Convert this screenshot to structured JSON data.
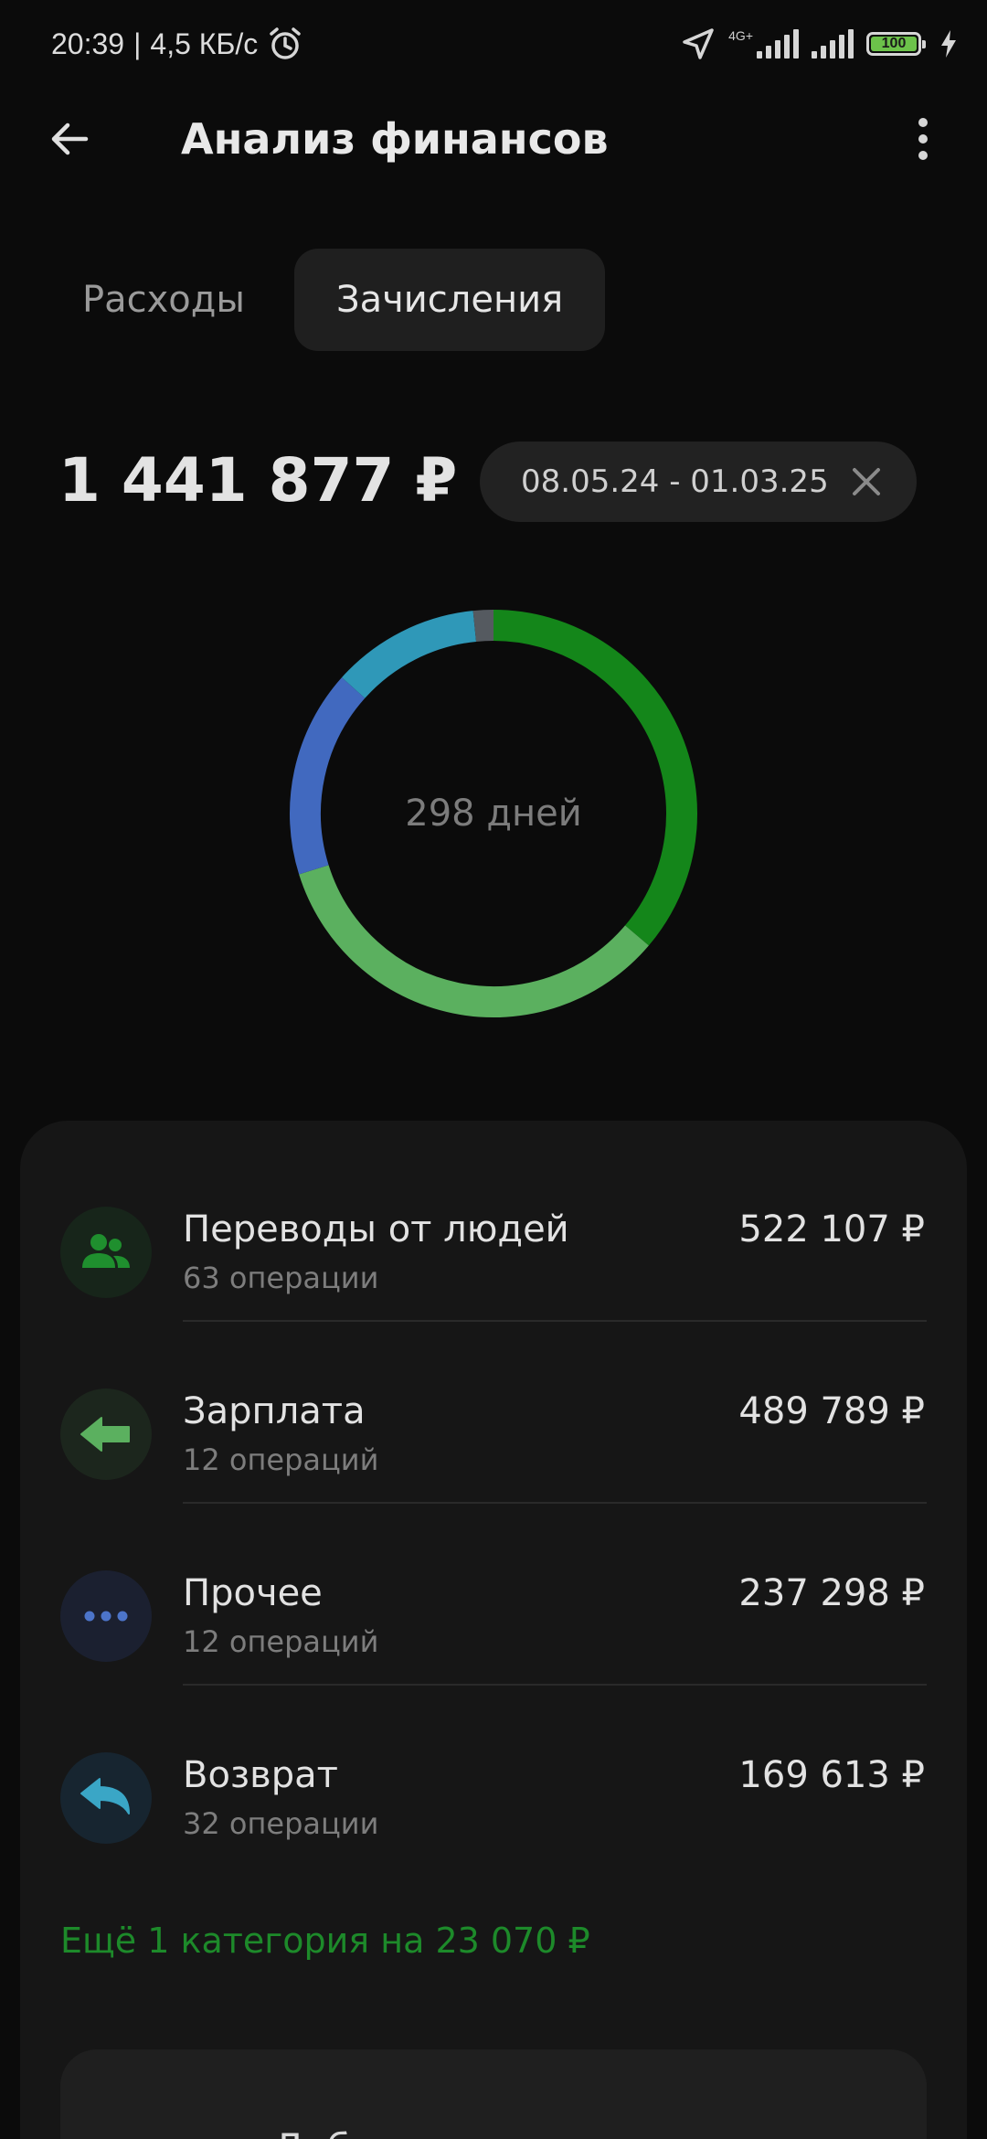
{
  "status_bar": {
    "time": "20:39",
    "separator": "|",
    "speed": "4,5 КБ/с",
    "network": "4G+",
    "battery_level": "100",
    "icons": [
      "alarm-icon",
      "location-arrow-icon",
      "signal-icon",
      "battery-icon",
      "charging-icon"
    ]
  },
  "header": {
    "title": "Анализ финансов",
    "back_icon": "arrow-left-icon",
    "menu_icon": "more-vertical-icon"
  },
  "tabs": [
    {
      "label": "Расходы",
      "active": false
    },
    {
      "label": "Зачисления",
      "active": true
    }
  ],
  "summary": {
    "total": "1 441 877 ₽",
    "date_range": "08.05.24 - 01.03.25",
    "clear_icon": "close-icon"
  },
  "donut": {
    "center_label": "298 дней",
    "segments": [
      {
        "name": "Переводы от людей",
        "value": 522107,
        "color": "#14861a"
      },
      {
        "name": "Зарплата",
        "value": 489789,
        "color": "#5bb05f"
      },
      {
        "name": "Прочее",
        "value": 237298,
        "color": "#4169bf"
      },
      {
        "name": "Возврат",
        "value": 169613,
        "color": "#2f98b8"
      },
      {
        "name": "other",
        "value": 23070,
        "color": "#555a60"
      }
    ]
  },
  "categories": [
    {
      "title": "Переводы от людей",
      "count": "63 операции",
      "amount": "522 107 ₽",
      "icon": "people-icon",
      "icon_color": "#1f8f2e",
      "icon_bg": "#17251a"
    },
    {
      "title": "Зарплата",
      "count": "12 операций",
      "amount": "489 789 ₽",
      "icon": "arrow-left-icon",
      "icon_color": "#5bb05f",
      "icon_bg": "#1c261d"
    },
    {
      "title": "Прочее",
      "count": "12 операций",
      "amount": "237 298 ₽",
      "icon": "dots-icon",
      "icon_color": "#4c74c9",
      "icon_bg": "#1b2030"
    },
    {
      "title": "Возврат",
      "count": "32 операции",
      "amount": "169 613 ₽",
      "icon": "return-arrow-icon",
      "icon_color": "#3aa6c6",
      "icon_bg": "#172530"
    }
  ],
  "more_link": "Ещё 1 категория на 23 070 ₽",
  "add_button": "Добавить зачисление"
}
